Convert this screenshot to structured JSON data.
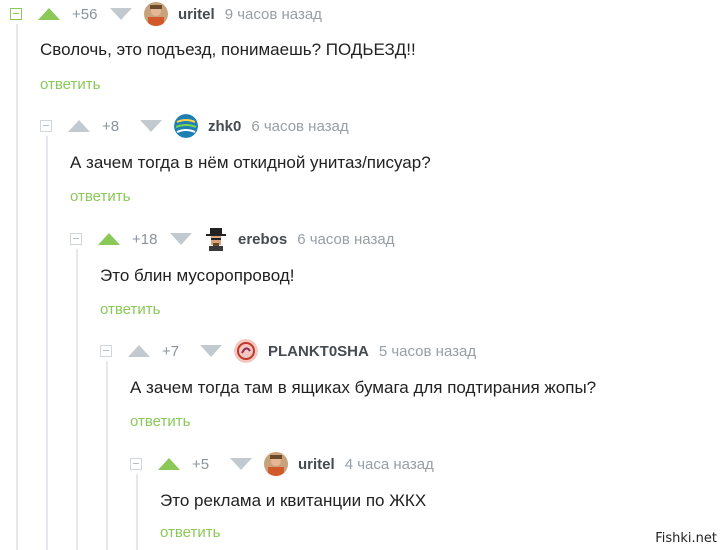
{
  "comments": [
    {
      "rating": "+56",
      "user": "uritel",
      "time": "9 часов назад",
      "text": "Сволочь, это подъезд, понимаешь? ПОДЬЕЗД!!",
      "reply": "ответить",
      "avatar": "uritel-avatar",
      "upvoted": false
    },
    {
      "rating": "+8",
      "user": "zhk0",
      "time": "6 часов назад",
      "text": "А зачем тогда в нём откидной унитаз/писуар?",
      "reply": "ответить",
      "avatar": "globe-avatar",
      "upvoted": false
    },
    {
      "rating": "+18",
      "user": "erebos",
      "time": "6 часов назад",
      "text": "Это блин мусоропровод!",
      "reply": "ответить",
      "avatar": "heisenberg-avatar",
      "upvoted": true
    },
    {
      "rating": "+7",
      "user": "PLANKT0SHA",
      "time": "5 часов назад",
      "text": "А зачем тогда там в ящиках бумага для подтирания жопы?",
      "reply": "ответить",
      "avatar": "plankt0sha-avatar",
      "upvoted": false
    },
    {
      "rating": "+5",
      "user": "uritel",
      "time": "4 часа назад",
      "text": "Это реклама и квитанции по ЖКХ",
      "reply": "ответить",
      "avatar": "uritel-avatar",
      "upvoted": true
    }
  ],
  "watermark": "Fishki.net",
  "colors": {
    "accent": "#8ac858",
    "muted": "#c3cacf",
    "text": "#222222"
  }
}
